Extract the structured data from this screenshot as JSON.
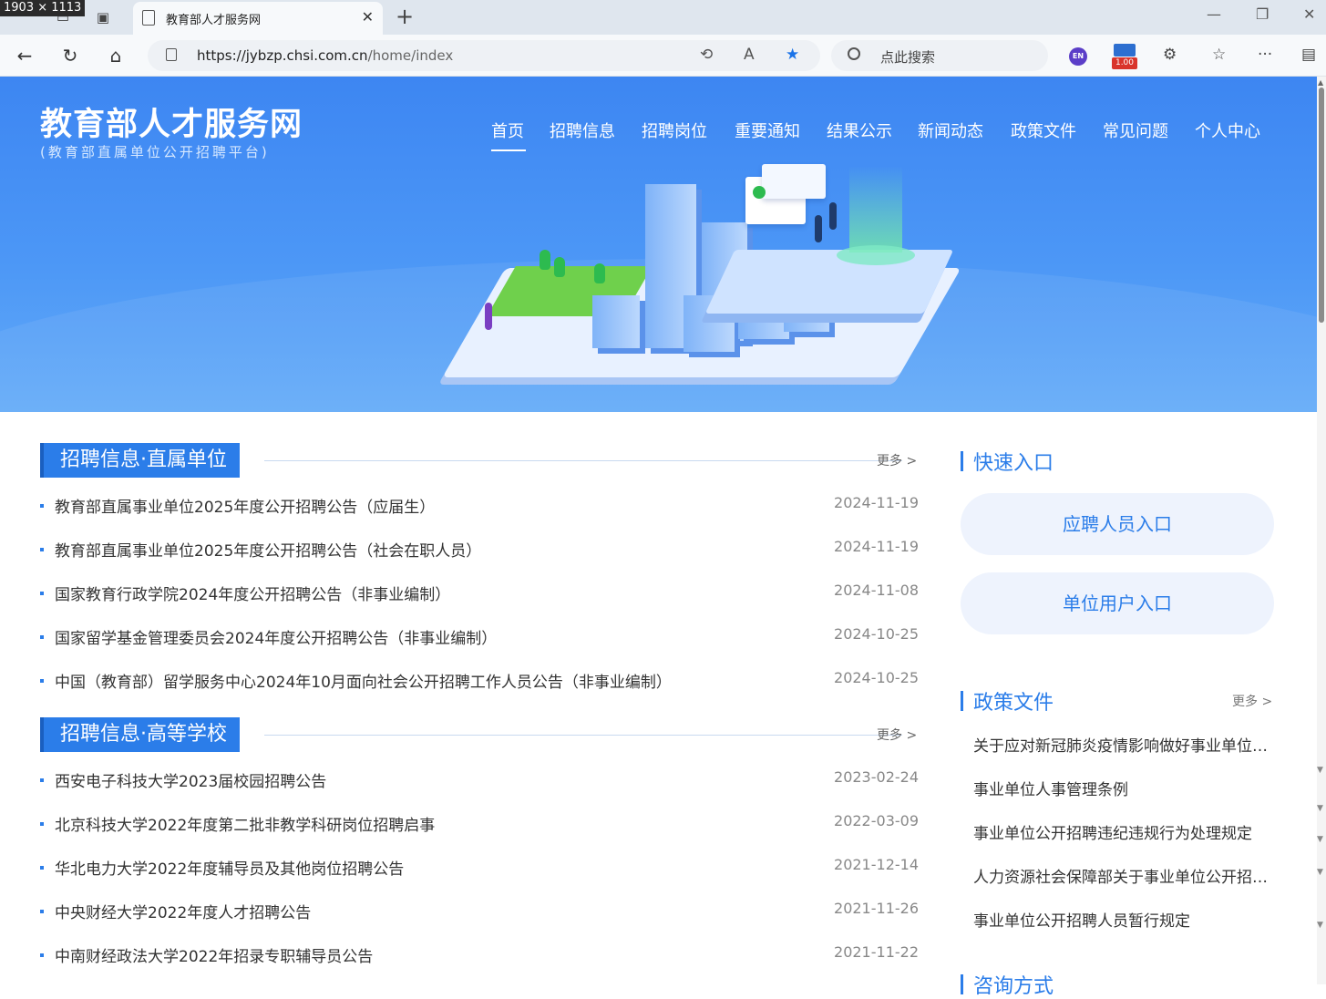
{
  "overlay": {
    "dimensions": "1903 × 1113"
  },
  "browser": {
    "tab_title": "教育部人才服务网",
    "url_host": "https://jybzp.chsi.com.cn",
    "url_path": "/home/index",
    "search_placeholder": "点此搜索",
    "lang_badge": "EN",
    "version_badge": "1.00"
  },
  "site": {
    "title": "教育部人才服务网",
    "subtitle": "(教育部直属单位公开招聘平台)"
  },
  "nav": [
    "首页",
    "招聘信息",
    "招聘岗位",
    "重要通知",
    "结果公示",
    "新闻动态",
    "政策文件",
    "常见问题",
    "个人中心"
  ],
  "sections": {
    "direct": {
      "title": "招聘信息·直属单位",
      "more": "更多 >",
      "items": [
        {
          "title": "教育部直属事业单位2025年度公开招聘公告（应届生）",
          "date": "2024-11-19"
        },
        {
          "title": "教育部直属事业单位2025年度公开招聘公告（社会在职人员）",
          "date": "2024-11-19"
        },
        {
          "title": "国家教育行政学院2024年度公开招聘公告（非事业编制）",
          "date": "2024-11-08"
        },
        {
          "title": "国家留学基金管理委员会2024年度公开招聘公告（非事业编制）",
          "date": "2024-10-25"
        },
        {
          "title": "中国（教育部）留学服务中心2024年10月面向社会公开招聘工作人员公告（非事业编制）",
          "date": "2024-10-25"
        }
      ]
    },
    "universities": {
      "title": "招聘信息·高等学校",
      "more": "更多 >",
      "items": [
        {
          "title": "西安电子科技大学2023届校园招聘公告",
          "date": "2023-02-24"
        },
        {
          "title": "北京科技大学2022年度第二批非教学科研岗位招聘启事",
          "date": "2022-03-09"
        },
        {
          "title": "华北电力大学2022年度辅导员及其他岗位招聘公告",
          "date": "2021-12-14"
        },
        {
          "title": "中央财经大学2022年度人才招聘公告",
          "date": "2021-11-26"
        },
        {
          "title": "中南财经政法大学2022年招录专职辅导员公告",
          "date": "2021-11-22"
        }
      ]
    }
  },
  "quick_entry": {
    "title": "快速入口",
    "buttons": [
      "应聘人员入口",
      "单位用户入口"
    ]
  },
  "policy": {
    "title": "政策文件",
    "more": "更多 >",
    "items": [
      "关于应对新冠肺炎疫情影响做好事业单位公开招聘高校毕业生工作的通知",
      "事业单位人事管理条例",
      "事业单位公开招聘违纪违规行为处理规定",
      "人力资源社会保障部关于事业单位公开招聘岗位条件设置有关问题的通知",
      "事业单位公开招聘人员暂行规定"
    ]
  },
  "consult": {
    "title": "咨询方式"
  }
}
